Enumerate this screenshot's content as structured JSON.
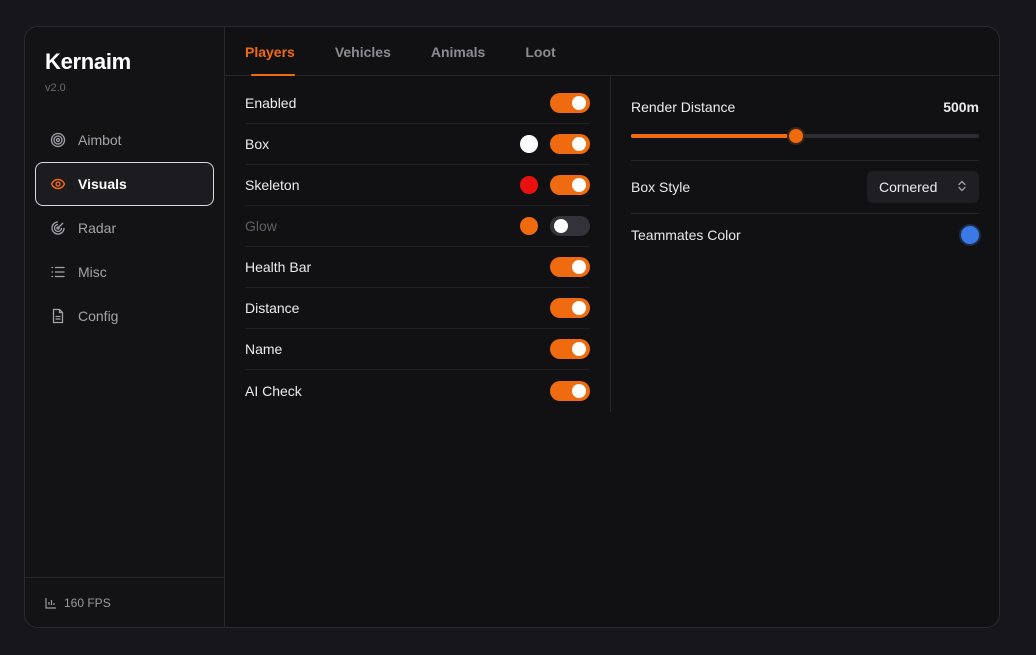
{
  "app": {
    "title": "Kernaim",
    "version": "v2.0"
  },
  "sidebar": {
    "items": [
      {
        "label": "Aimbot",
        "icon": "target-icon",
        "active": false
      },
      {
        "label": "Visuals",
        "icon": "eye-icon",
        "active": true
      },
      {
        "label": "Radar",
        "icon": "radar-icon",
        "active": false
      },
      {
        "label": "Misc",
        "icon": "list-icon",
        "active": false
      },
      {
        "label": "Config",
        "icon": "file-icon",
        "active": false
      }
    ],
    "footer": {
      "icon": "bar-chart-icon",
      "fps": "160 FPS"
    }
  },
  "tabs": [
    {
      "label": "Players",
      "active": true
    },
    {
      "label": "Vehicles",
      "active": false
    },
    {
      "label": "Animals",
      "active": false
    },
    {
      "label": "Loot",
      "active": false
    }
  ],
  "players": {
    "rows": [
      {
        "label": "Enabled",
        "toggle": true,
        "color": null,
        "disabled": false
      },
      {
        "label": "Box",
        "toggle": true,
        "color": "#ffffff",
        "disabled": false
      },
      {
        "label": "Skeleton",
        "toggle": true,
        "color": "#e8110f",
        "disabled": false
      },
      {
        "label": "Glow",
        "toggle": false,
        "color": "#f06a10",
        "disabled": true
      },
      {
        "label": "Health Bar",
        "toggle": true,
        "color": null,
        "disabled": false
      },
      {
        "label": "Distance",
        "toggle": true,
        "color": null,
        "disabled": false
      },
      {
        "label": "Name",
        "toggle": true,
        "color": null,
        "disabled": false
      },
      {
        "label": "AI Check",
        "toggle": true,
        "color": null,
        "disabled": false
      }
    ]
  },
  "settings": {
    "render_distance": {
      "label": "Render Distance",
      "value_text": "500m",
      "fraction": 0.475
    },
    "box_style": {
      "label": "Box Style",
      "selected": "Cornered"
    },
    "teammates_color": {
      "label": "Teammates Color",
      "color": "#3b7ae6"
    }
  },
  "colors": {
    "accent": "#f06a10",
    "background": "#111114"
  }
}
